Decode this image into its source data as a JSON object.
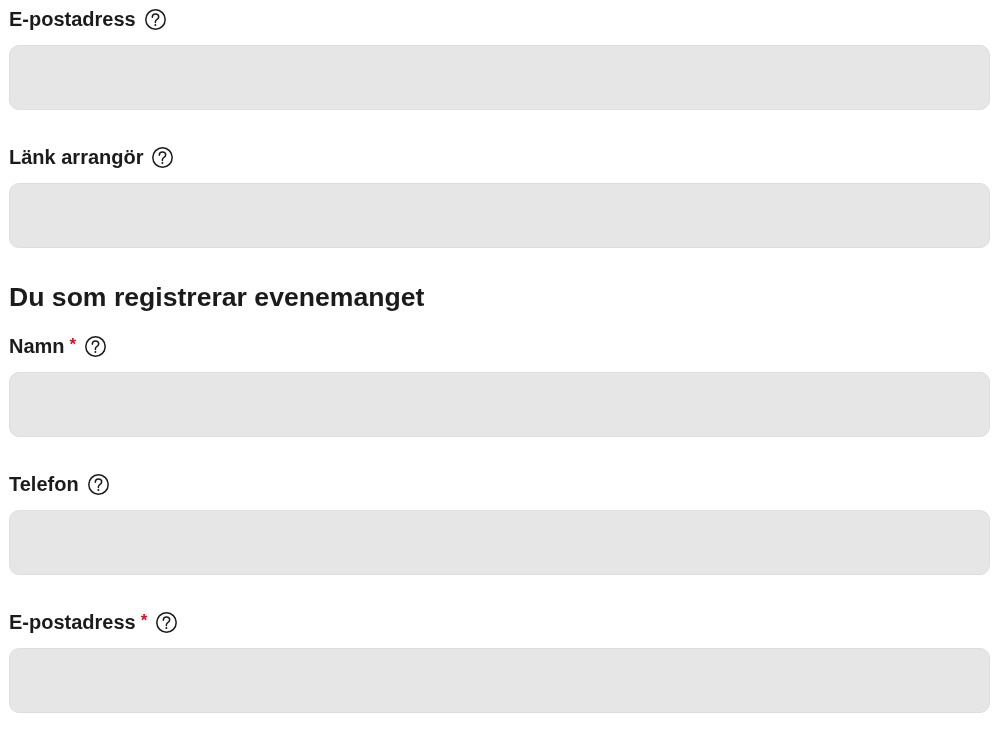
{
  "groups": [
    {
      "fields": [
        {
          "label": "E-postadress"
        },
        {
          "label": "Länk arrangör"
        }
      ]
    },
    {
      "heading": "Du som registrerar evenemanget",
      "fields": [
        {
          "label": "Namn",
          "required_mark": "*"
        },
        {
          "label": "Telefon"
        },
        {
          "label": "E-postadress",
          "required_mark": "*"
        }
      ]
    }
  ]
}
